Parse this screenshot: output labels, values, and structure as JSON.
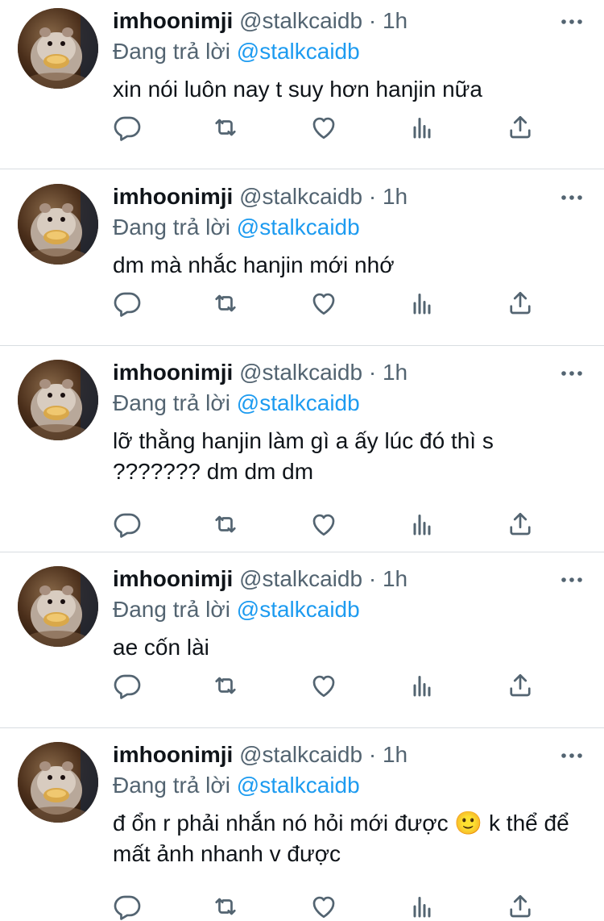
{
  "tweets": [
    {
      "display_name": "imhoonimji",
      "handle": "@stalkcaidb",
      "separator": "·",
      "time": "1h",
      "reply_prefix": "Đang trả lời",
      "reply_to": "@stalkcaidb",
      "text": "xin nói luôn nay t suy hơn hanjin nữa"
    },
    {
      "display_name": "imhoonimji",
      "handle": "@stalkcaidb",
      "separator": "·",
      "time": "1h",
      "reply_prefix": "Đang trả lời",
      "reply_to": "@stalkcaidb",
      "text": "dm mà nhắc hanjin mới nhớ"
    },
    {
      "display_name": "imhoonimji",
      "handle": "@stalkcaidb",
      "separator": "·",
      "time": "1h",
      "reply_prefix": "Đang trả lời",
      "reply_to": "@stalkcaidb",
      "text": "lỡ thằng hanjin làm gì a ấy lúc đó thì s ??????? dm dm dm"
    },
    {
      "display_name": "imhoonimji",
      "handle": "@stalkcaidb",
      "separator": "·",
      "time": "1h",
      "reply_prefix": "Đang trả lời",
      "reply_to": "@stalkcaidb",
      "text": "ae cốn lài"
    },
    {
      "display_name": "imhoonimji",
      "handle": "@stalkcaidb",
      "separator": "·",
      "time": "1h",
      "reply_prefix": "Đang trả lời",
      "reply_to": "@stalkcaidb",
      "text": "đ ổn r phải nhắn nó hỏi mới được 🙂  k thể để mất ảnh nhanh v được"
    }
  ],
  "icons": {
    "more": "more-horizontal-icon",
    "reply": "reply-icon",
    "retweet": "retweet-icon",
    "like": "heart-icon",
    "views": "analytics-icon",
    "share": "share-icon"
  },
  "colors": {
    "text": "#0f1419",
    "muted": "#536471",
    "mention": "#1d9bf0",
    "divider": "#d8dde1"
  }
}
